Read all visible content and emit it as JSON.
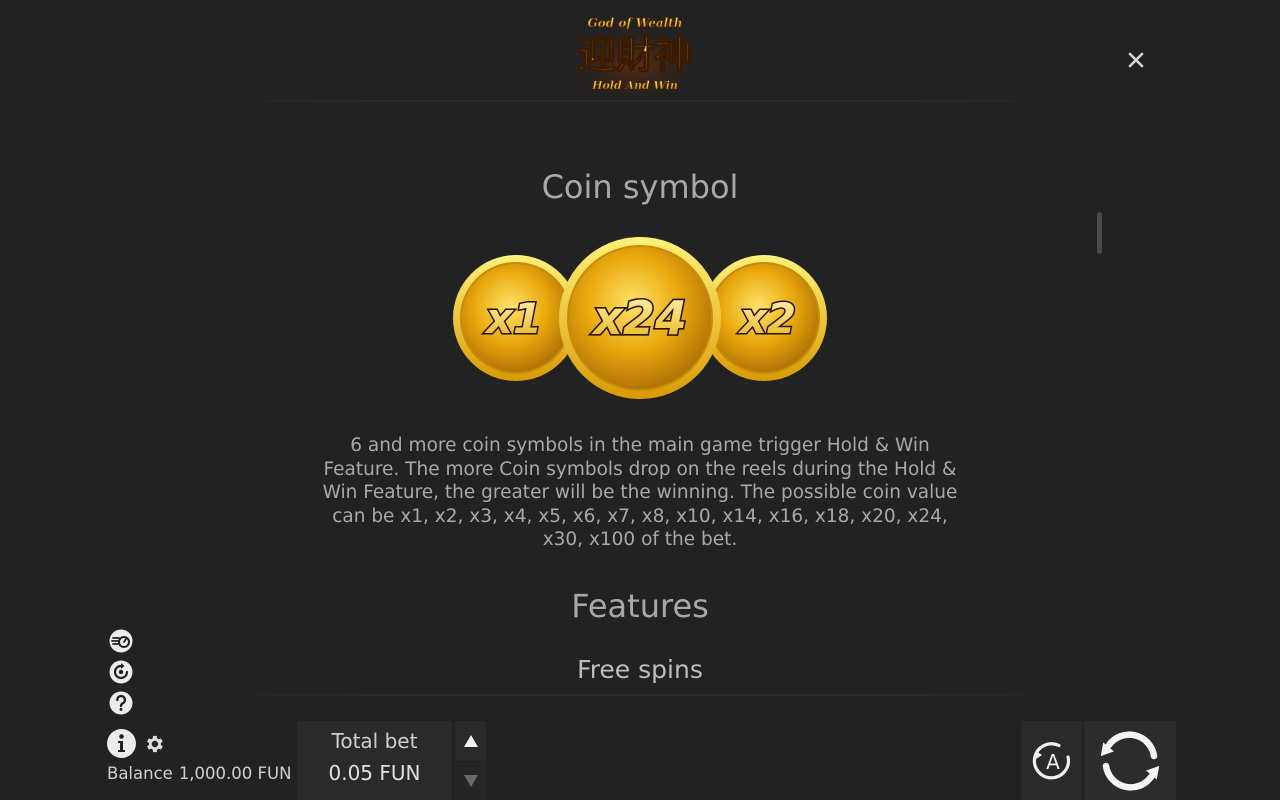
{
  "logo": {
    "top_text": "God of Wealth",
    "chinese_text": "迎財神",
    "bottom_text": "Hold And Win"
  },
  "header": {
    "close_icon": "close-icon"
  },
  "coin_section": {
    "title": "Coin symbol",
    "coins": [
      "x1",
      "x24",
      "x2"
    ],
    "description": "6 and more coin symbols in the main game trigger Hold & Win Feature. The more Coin symbols drop on the reels during the Hold & Win Feature, the greater will be the winning. The possible coin value can be x1, x2, x3, x4, x5, x6, x7, x8, x10, x14, x16, x18, x20, x24, x30, x100 of the bet."
  },
  "features_section": {
    "title": "Features",
    "subtitle": "Free spins"
  },
  "side_icons": [
    "turbo-icon",
    "autoplay-settings-icon",
    "help-icon"
  ],
  "footer": {
    "info_icon": "info-icon",
    "settings_icon": "gear-icon",
    "balance_label": "Balance",
    "balance_value": "1,000.00 FUN",
    "total_bet_label": "Total bet",
    "total_bet_value": "0.05 FUN",
    "autoplay_label": "A",
    "spin_icon": "spin-icon"
  },
  "colors": {
    "background": "#222222",
    "text": "#a8a8a8",
    "gold": "#f5c518"
  }
}
